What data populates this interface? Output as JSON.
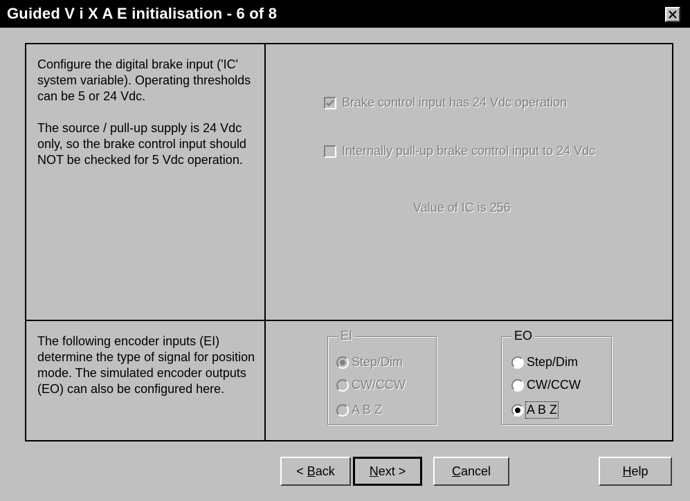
{
  "window": {
    "title": "Guided V i X A E initialisation - 6 of 8",
    "close_icon": "close-icon"
  },
  "panel_brake": {
    "description": "Configure the digital brake input ('IC' system variable). Operating thresholds can be 5 or 24 Vdc.\n\nThe source / pull-up supply is 24 Vdc only, so the brake control input should NOT be checked for 5 Vdc operation.",
    "checkbox_24v": {
      "label": "Brake control input has 24 Vdc operation",
      "checked": true,
      "enabled": false
    },
    "checkbox_pullup": {
      "label": "Internally pull-up brake control input to 24 Vdc",
      "checked": false,
      "enabled": false
    },
    "ic_value": "Value of IC is 256"
  },
  "panel_encoder": {
    "description": "The following encoder inputs (EI) determine the type of signal for position mode.  The simulated encoder outputs (EO) can also be configured here.",
    "ei": {
      "label": "EI",
      "enabled": false,
      "options": [
        "Step/Dim",
        "CW/CCW",
        "A B Z"
      ],
      "selected": "Step/Dim"
    },
    "eo": {
      "label": "EO",
      "enabled": true,
      "options": [
        "Step/Dim",
        "CW/CCW",
        "A B Z"
      ],
      "selected": "A B Z"
    }
  },
  "buttons": {
    "back": {
      "prefix": "< ",
      "mnemonic": "B",
      "rest": "ack"
    },
    "next": {
      "mnemonic": "N",
      "rest": "ext >"
    },
    "cancel": {
      "mnemonic": "C",
      "rest": "ancel"
    },
    "help": {
      "mnemonic": "H",
      "rest": "elp"
    }
  }
}
